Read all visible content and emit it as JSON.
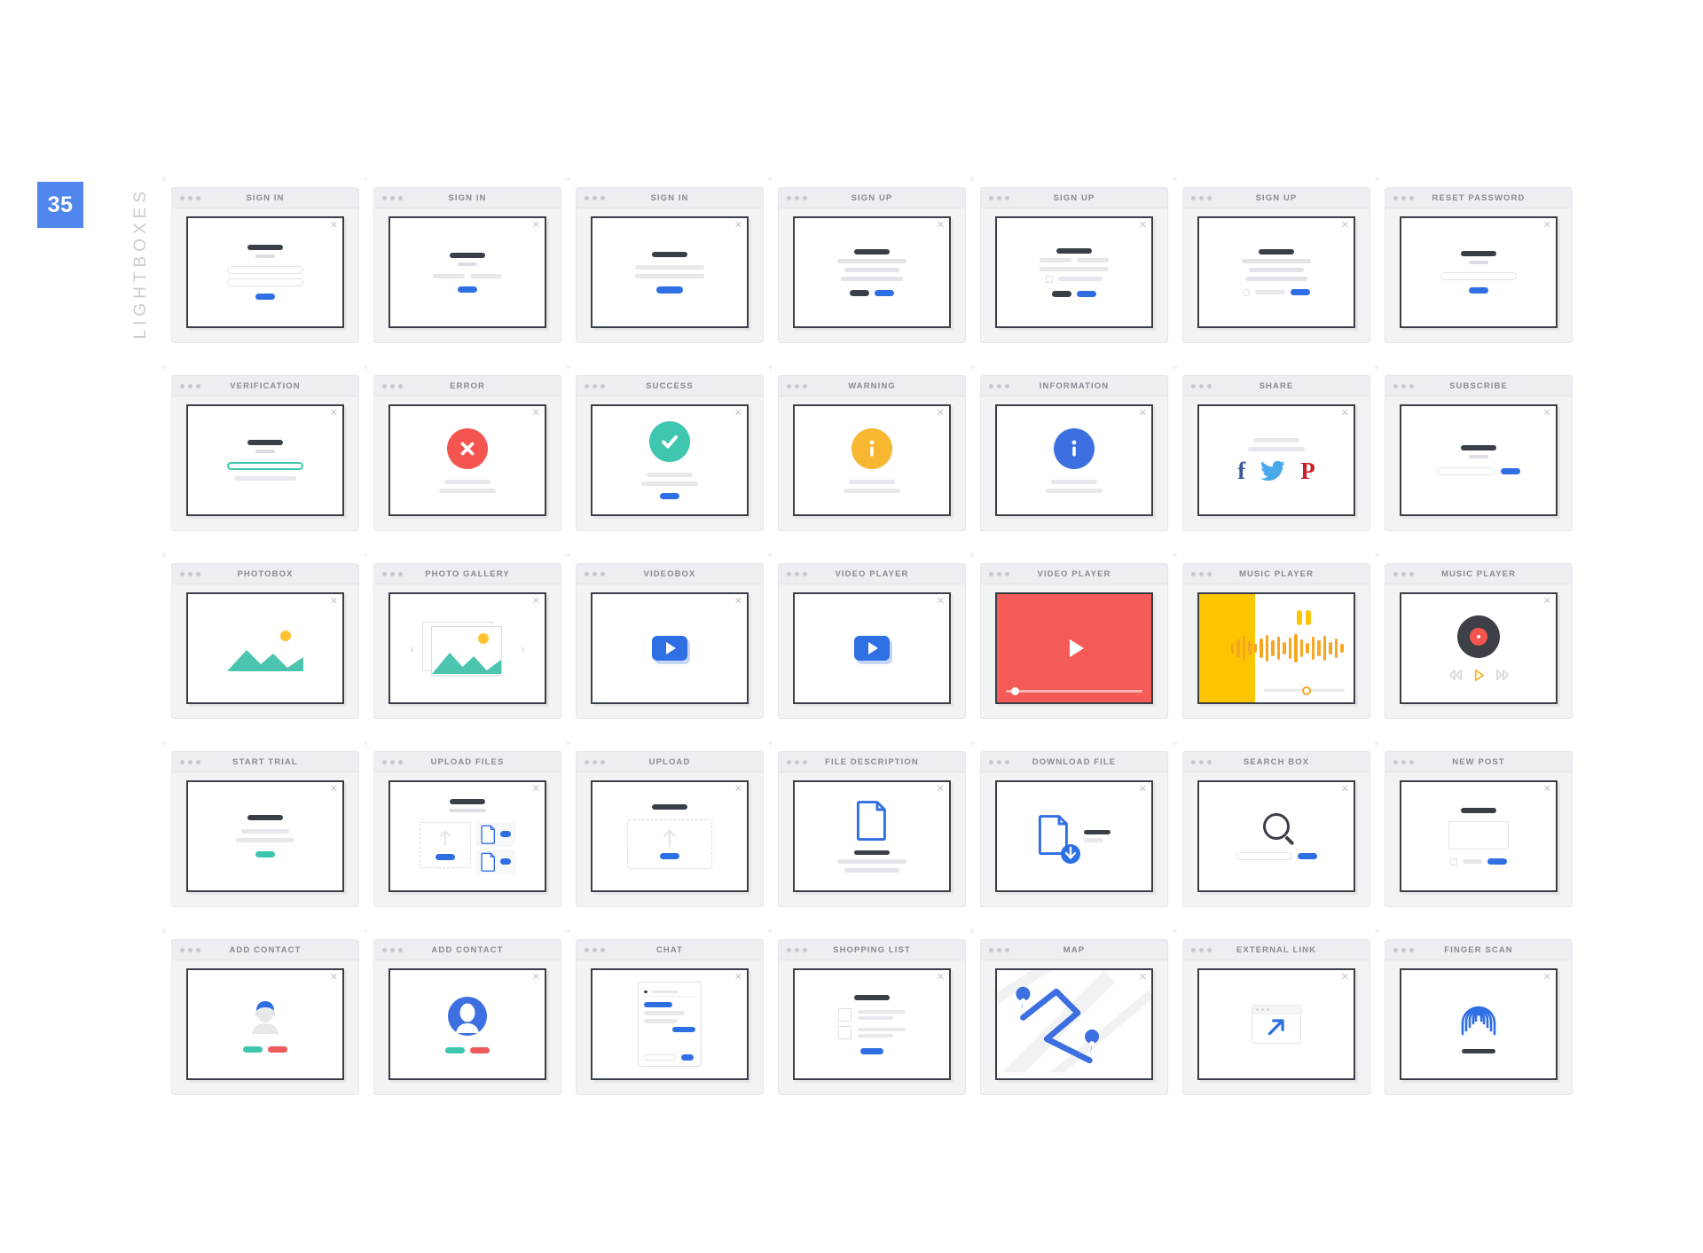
{
  "rail": {
    "number": "35",
    "label": "LIGHTBOXES"
  },
  "window_dots": [
    "dot-1",
    "dot-2",
    "dot-3"
  ],
  "close_glyph": "✕",
  "colors": {
    "accent_blue": "#2f6fe4",
    "badge_blue": "#5186ec",
    "error_red": "#f4554f",
    "success_teal": "#3ec6ae",
    "warning_yellow": "#f7b731",
    "info_blue": "#3d6fe0",
    "music_yellow": "#fdc500",
    "facebook_blue": "#3b5998",
    "twitter_blue": "#4aa9ea",
    "pinterest_red": "#cb2027",
    "frame_dark": "#3a3f47",
    "chrome_gray": "#eceef1"
  },
  "cards": [
    {
      "title": "SIGN IN",
      "name": "card-sign-in-1"
    },
    {
      "title": "SIGN IN",
      "name": "card-sign-in-2"
    },
    {
      "title": "SIGN IN",
      "name": "card-sign-in-3"
    },
    {
      "title": "SIGN UP",
      "name": "card-sign-up-1"
    },
    {
      "title": "SIGN UP",
      "name": "card-sign-up-2"
    },
    {
      "title": "SIGN UP",
      "name": "card-sign-up-3"
    },
    {
      "title": "RESET PASSWORD",
      "name": "card-reset-password"
    },
    {
      "title": "VERIFICATION",
      "name": "card-verification"
    },
    {
      "title": "ERROR",
      "name": "card-error"
    },
    {
      "title": "SUCCESS",
      "name": "card-success"
    },
    {
      "title": "WARNING",
      "name": "card-warning"
    },
    {
      "title": "INFORMATION",
      "name": "card-information"
    },
    {
      "title": "SHARE",
      "name": "card-share"
    },
    {
      "title": "SUBSCRIBE",
      "name": "card-subscribe"
    },
    {
      "title": "PHOTOBOX",
      "name": "card-photobox"
    },
    {
      "title": "PHOTO GALLERY",
      "name": "card-photo-gallery"
    },
    {
      "title": "VIDEOBOX",
      "name": "card-videobox"
    },
    {
      "title": "VIDEO PLAYER",
      "name": "card-video-player-1"
    },
    {
      "title": "VIDEO PLAYER",
      "name": "card-video-player-2"
    },
    {
      "title": "MUSIC PLAYER",
      "name": "card-music-player-1"
    },
    {
      "title": "MUSIC PLAYER",
      "name": "card-music-player-2"
    },
    {
      "title": "START TRIAL",
      "name": "card-start-trial"
    },
    {
      "title": "UPLOAD FILES",
      "name": "card-upload-files"
    },
    {
      "title": "UPLOAD",
      "name": "card-upload"
    },
    {
      "title": "FILE DESCRIPTION",
      "name": "card-file-description"
    },
    {
      "title": "DOWNLOAD FILE",
      "name": "card-download-file"
    },
    {
      "title": "SEARCH BOX",
      "name": "card-search-box"
    },
    {
      "title": "NEW POST",
      "name": "card-new-post"
    },
    {
      "title": "ADD CONTACT",
      "name": "card-add-contact-1"
    },
    {
      "title": "ADD CONTACT",
      "name": "card-add-contact-2"
    },
    {
      "title": "CHAT",
      "name": "card-chat"
    },
    {
      "title": "SHOPPING LIST",
      "name": "card-shopping-list"
    },
    {
      "title": "MAP",
      "name": "card-map"
    },
    {
      "title": "EXTERNAL LINK",
      "name": "card-external-link"
    },
    {
      "title": "FINGER SCAN",
      "name": "card-finger-scan"
    }
  ],
  "social": {
    "facebook": "f",
    "twitter": "t",
    "pinterest": "P"
  },
  "grid": {
    "columns": 7,
    "rows": 5,
    "total": 35
  }
}
